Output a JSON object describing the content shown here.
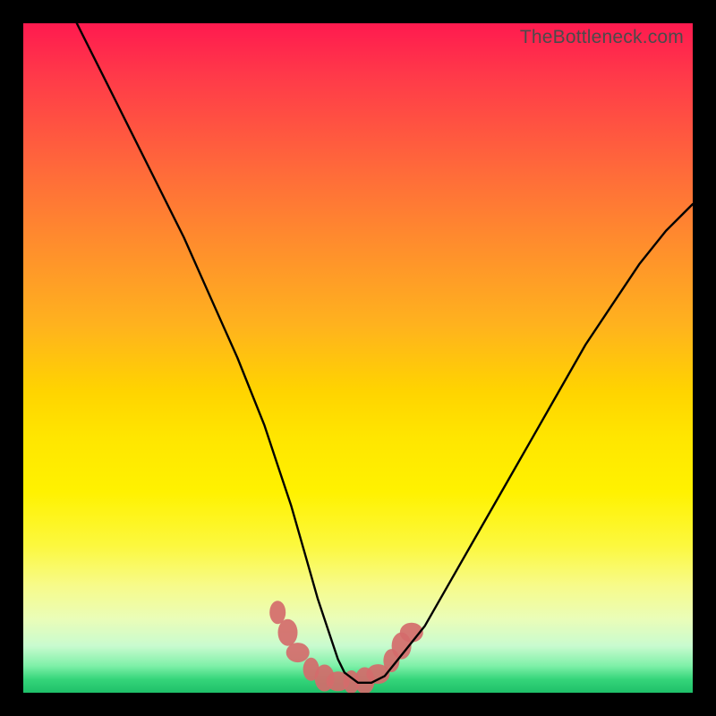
{
  "watermark": "TheBottleneck.com",
  "chart_data": {
    "type": "line",
    "title": "",
    "xlabel": "",
    "ylabel": "",
    "xlim": [
      0,
      100
    ],
    "ylim": [
      0,
      100
    ],
    "series": [
      {
        "name": "bottleneck-curve",
        "x": [
          8,
          12,
          16,
          20,
          24,
          28,
          32,
          36,
          38,
          40,
          42,
          44,
          46,
          47,
          48,
          50,
          52,
          54,
          56,
          60,
          64,
          68,
          72,
          76,
          80,
          84,
          88,
          92,
          96,
          100
        ],
        "values": [
          100,
          92,
          84,
          76,
          68,
          59,
          50,
          40,
          34,
          28,
          21,
          14,
          8,
          5,
          3,
          1.5,
          1.5,
          2.5,
          5,
          10,
          17,
          24,
          31,
          38,
          45,
          52,
          58,
          64,
          69,
          73
        ]
      }
    ],
    "markers": {
      "name": "highlight-blobs",
      "color": "#d46b6b",
      "points": [
        {
          "x": 38,
          "y": 12
        },
        {
          "x": 39.5,
          "y": 9
        },
        {
          "x": 41,
          "y": 6
        },
        {
          "x": 43,
          "y": 3.5
        },
        {
          "x": 45,
          "y": 2.2
        },
        {
          "x": 47,
          "y": 1.7
        },
        {
          "x": 49,
          "y": 1.6
        },
        {
          "x": 51,
          "y": 1.8
        },
        {
          "x": 53,
          "y": 2.8
        },
        {
          "x": 55,
          "y": 4.8
        },
        {
          "x": 56.5,
          "y": 7
        },
        {
          "x": 58,
          "y": 9
        }
      ]
    },
    "gradient_bands": [
      {
        "color": "#ff1a4f",
        "stop": 0
      },
      {
        "color": "#ffb21e",
        "stop": 45
      },
      {
        "color": "#fff200",
        "stop": 70
      },
      {
        "color": "#1fc069",
        "stop": 100
      }
    ]
  }
}
